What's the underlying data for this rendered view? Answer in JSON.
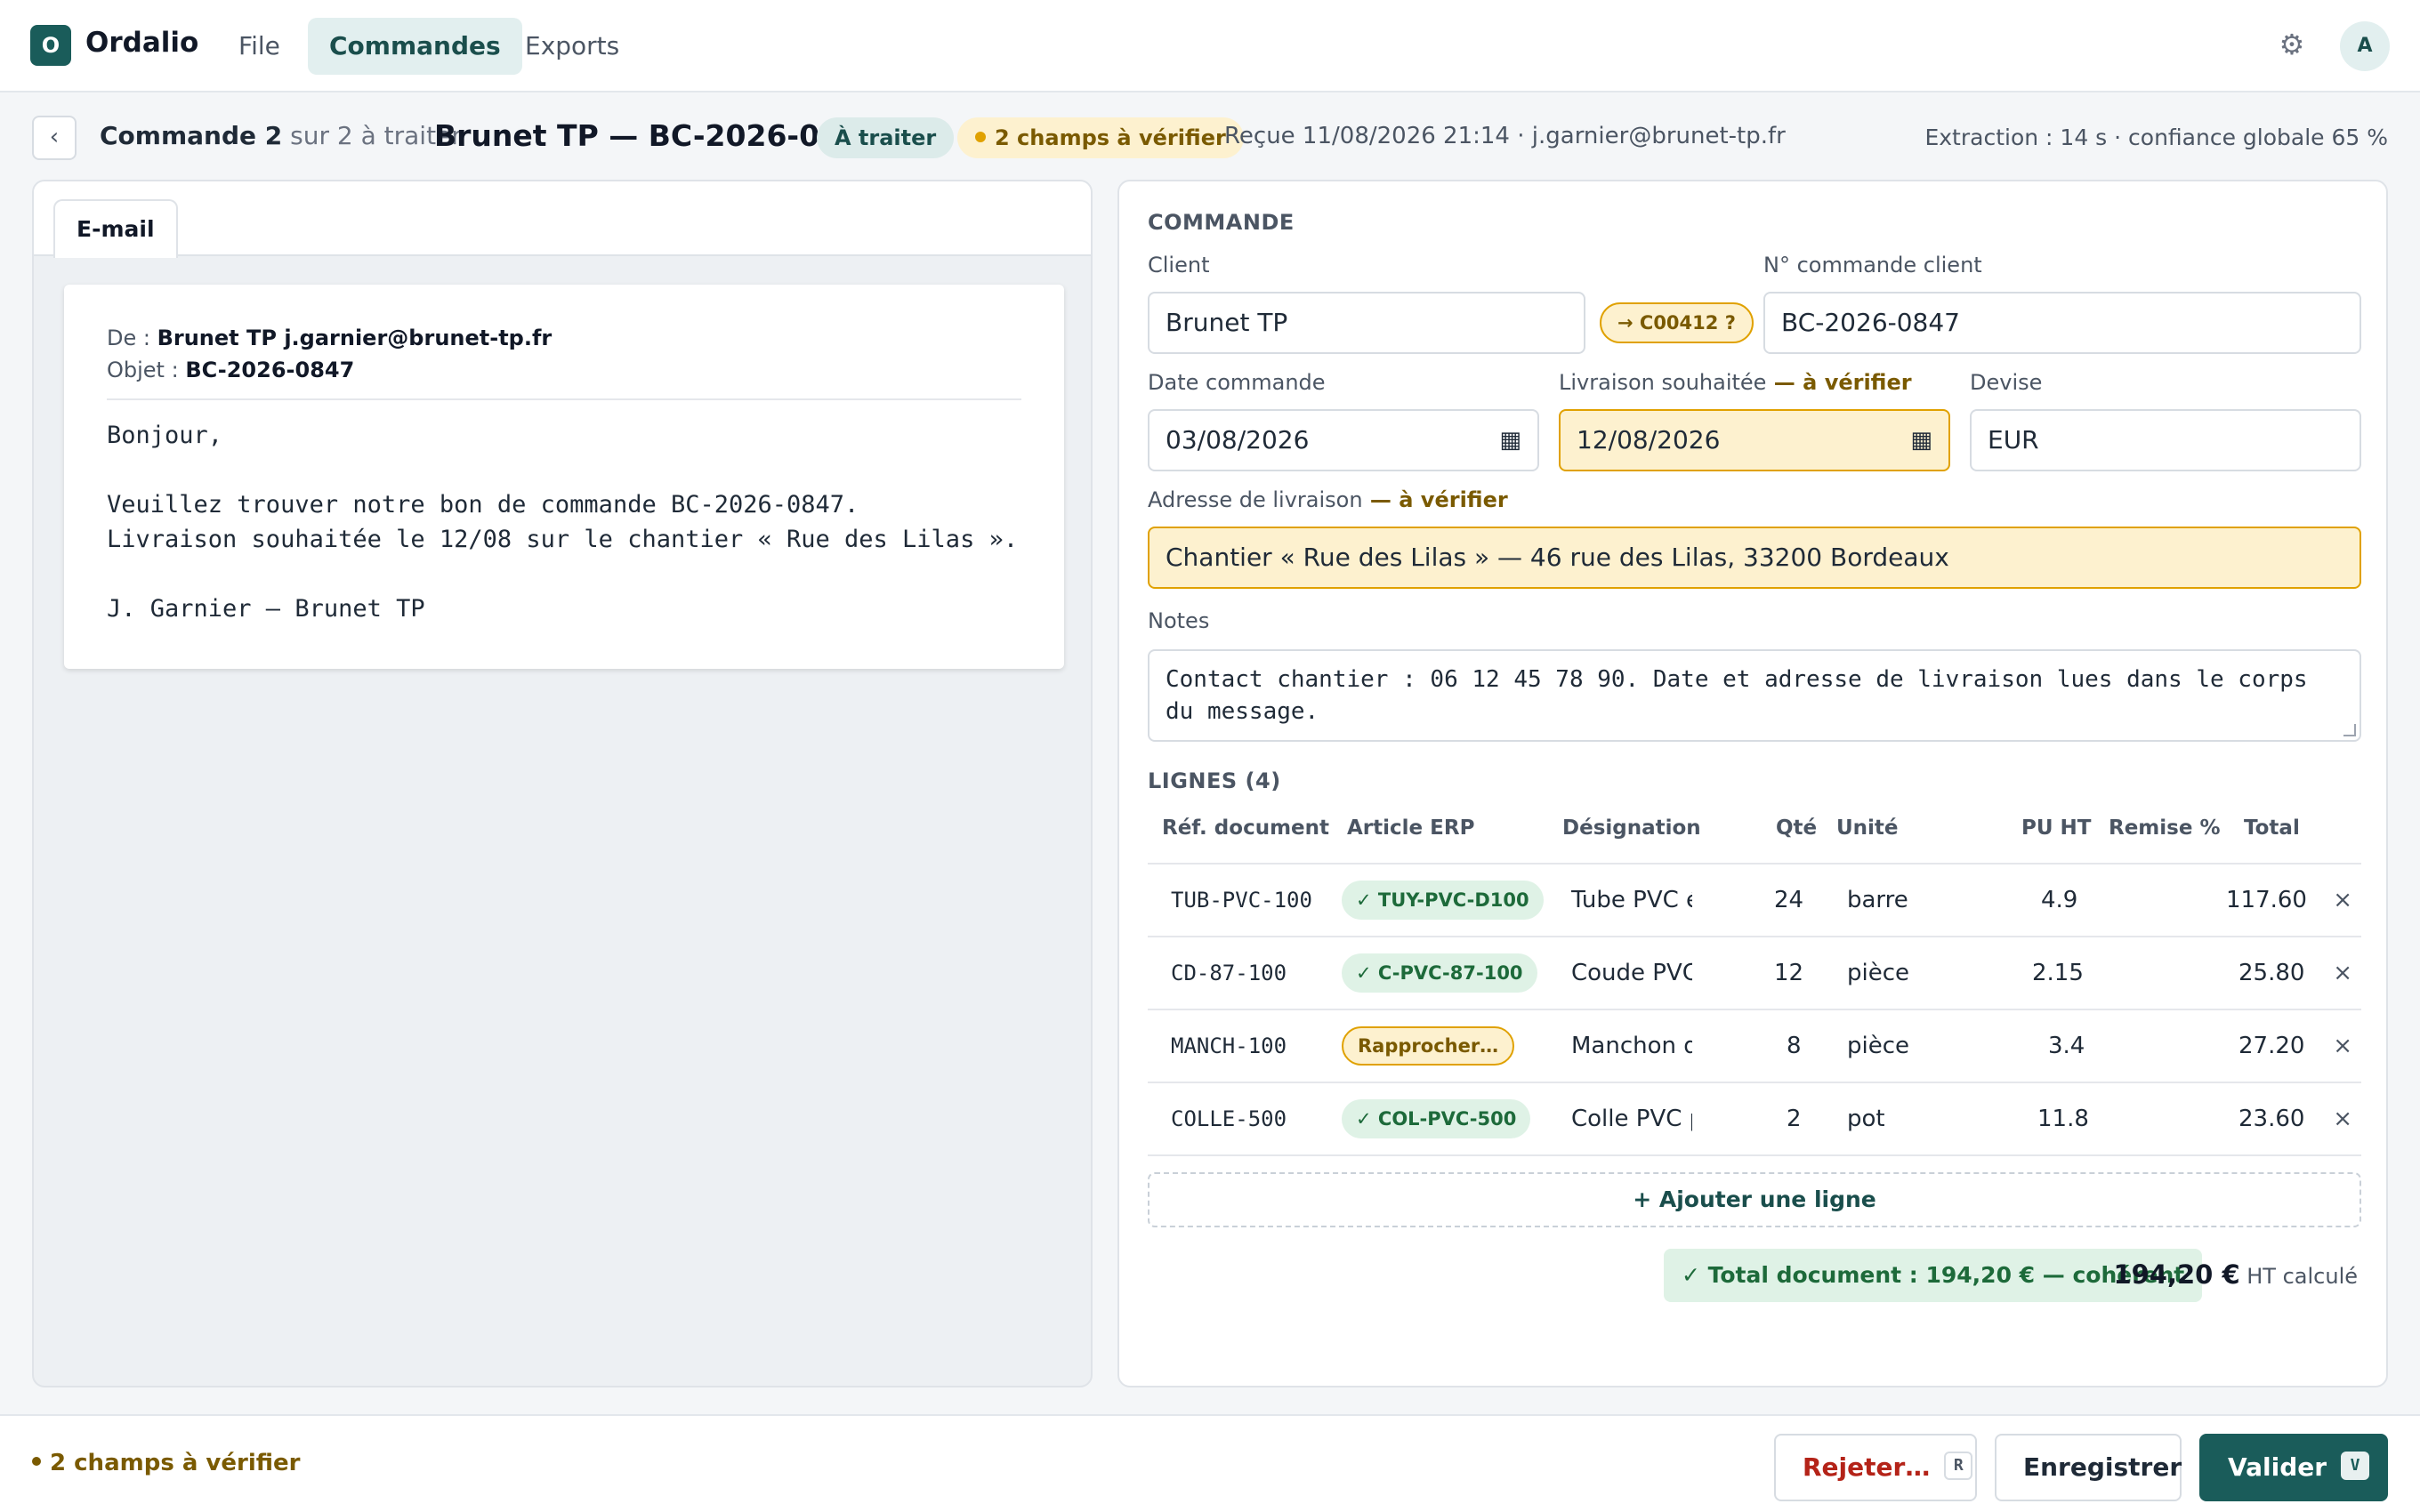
{
  "app": {
    "logo_letter": "O",
    "name": "Ordalio",
    "avatar": "A"
  },
  "nav": {
    "tabs": [
      {
        "label": "File",
        "active": false
      },
      {
        "label": "Commandes",
        "active": true
      },
      {
        "label": "Exports",
        "active": false
      }
    ]
  },
  "icons": {
    "settings": "gear-icon",
    "back": "chevron-left-icon",
    "calendar": "calendar-icon",
    "delete": "close-icon"
  },
  "header": {
    "back_glyph": "‹",
    "position_prefix": "Commande 2",
    "position_suffix": " sur 2 à traiter",
    "order_title": "Brunet TP — BC-2026-0847",
    "status": "À traiter",
    "warning": "2 champs à vérifier",
    "received": "Reçue 11/08/2026 21:14 · j.garnier@brunet-tp.fr",
    "extraction": "Extraction : 14 s · confiance globale 65 %"
  },
  "email": {
    "tab_label": "E-mail",
    "from_label": "De : ",
    "from_value": "Brunet TP j.garnier@brunet-tp.fr",
    "subject_label": "Objet : ",
    "subject_value": "BC-2026-0847",
    "body": "Bonjour,\n\nVeuillez trouver notre bon de commande BC-2026-0847.\nLivraison souhaitée le 12/08 sur le chantier « Rue des Lilas ».\n\nJ. Garnier — Brunet TP"
  },
  "form": {
    "section_title": "COMMANDE",
    "client_label": "Client",
    "client_value": "Brunet TP",
    "client_match": "→ C00412 ?",
    "customer_order_label": "N° commande client",
    "customer_order_value": "BC-2026-0847",
    "order_date_label": "Date commande",
    "order_date_value": "03/08/2026",
    "delivery_date_label": "Livraison souhaitée",
    "verify_flag": " — à vérifier",
    "delivery_date_value": "12/08/2026",
    "currency_label": "Devise",
    "currency_value": "EUR",
    "address_label": "Adresse de livraison",
    "address_value": "Chantier « Rue des Lilas » — 46 rue des Lilas, 33200 Bordeaux",
    "notes_label": "Notes",
    "notes_value": "Contact chantier : 06 12 45 78 90. Date et adresse de livraison lues dans le corps du message."
  },
  "lines": {
    "title": "LIGNES (4)",
    "columns": [
      "Réf. document",
      "Article ERP",
      "Désignation",
      "Qté",
      "Unité",
      "PU HT",
      "Remise %",
      "Total"
    ],
    "rows": [
      {
        "ref": "TUB-PVC-100",
        "erp": "✓ TUY-PVC-D100",
        "erp_status": "ok",
        "desig": "Tube PVC é",
        "qty": "24",
        "unit": "barre",
        "pu": "4.9",
        "remise": "",
        "total": "117.60"
      },
      {
        "ref": "CD-87-100",
        "erp": "✓ C-PVC-87-100",
        "erp_status": "ok",
        "desig": "Coude PVC",
        "qty": "12",
        "unit": "pièce",
        "pu": "2.15",
        "remise": "",
        "total": "25.80"
      },
      {
        "ref": "MANCH-100",
        "erp": "Rapprocher…",
        "erp_status": "todo",
        "desig": "Manchon d",
        "qty": "8",
        "unit": "pièce",
        "pu": "3.4",
        "remise": "",
        "total": "27.20"
      },
      {
        "ref": "COLLE-500",
        "erp": "✓ COL-PVC-500",
        "erp_status": "ok",
        "desig": "Colle PVC p",
        "qty": "2",
        "unit": "pot",
        "pu": "11.8",
        "remise": "",
        "total": "23.60"
      }
    ],
    "add_label": "+ Ajouter une ligne",
    "delete_glyph": "×"
  },
  "totals": {
    "check": "✓ Total document : 194,20 € — cohérent",
    "amount": "194,20 €",
    "suffix": " HT calculé"
  },
  "footer": {
    "warning": "2 champs à vérifier",
    "reject_label": "Rejeter…",
    "reject_key": "R",
    "save_label": "Enregistrer",
    "validate_label": "Valider",
    "validate_key": "V"
  }
}
